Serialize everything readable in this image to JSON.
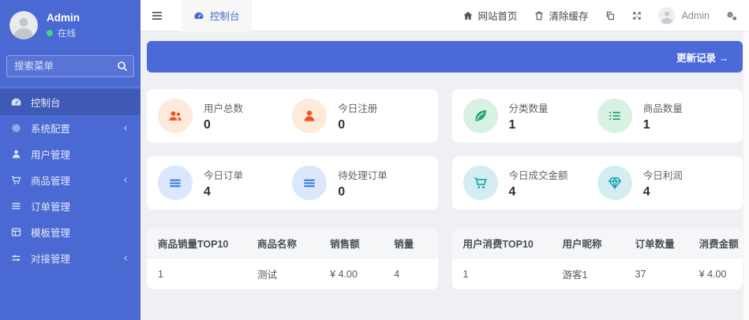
{
  "sidebar": {
    "user": {
      "name": "Admin",
      "status": "在线"
    },
    "search_placeholder": "搜索菜单",
    "items": [
      {
        "label": "控制台",
        "icon": "dashboard-icon"
      },
      {
        "label": "系统配置",
        "icon": "gear-icon"
      },
      {
        "label": "用户管理",
        "icon": "user-icon"
      },
      {
        "label": "商品管理",
        "icon": "cart-icon"
      },
      {
        "label": "订单管理",
        "icon": "list-icon"
      },
      {
        "label": "模板管理",
        "icon": "template-icon"
      },
      {
        "label": "对接管理",
        "icon": "sliders-icon"
      }
    ]
  },
  "navbar": {
    "tab_label": "控制台",
    "home_label": "网站首页",
    "clear_cache_label": "清除缓存",
    "user_name": "Admin"
  },
  "banner": {
    "link_label": "更新记录 →"
  },
  "stats": [
    {
      "label": "用户总数",
      "value": "0",
      "icon": "users-icon",
      "theme": "orange"
    },
    {
      "label": "今日注册",
      "value": "0",
      "icon": "user-icon",
      "theme": "orange"
    },
    {
      "label": "分类数量",
      "value": "1",
      "icon": "leaf-icon",
      "theme": "green"
    },
    {
      "label": "商品数量",
      "value": "1",
      "icon": "list-icon",
      "theme": "green"
    },
    {
      "label": "今日订单",
      "value": "4",
      "icon": "bars-icon",
      "theme": "blue"
    },
    {
      "label": "待处理订单",
      "value": "0",
      "icon": "bars-icon",
      "theme": "blue"
    },
    {
      "label": "今日成交金额",
      "value": "4",
      "icon": "cart-icon",
      "theme": "teal"
    },
    {
      "label": "今日利润",
      "value": "4",
      "icon": "gem-icon",
      "theme": "teal"
    }
  ],
  "tables": [
    {
      "headers": [
        "商品销量TOP10",
        "商品名称",
        "销售额",
        "销量"
      ],
      "rows": [
        [
          "1",
          "测试",
          "¥ 4.00",
          "4"
        ]
      ]
    },
    {
      "headers": [
        "用户消费TOP10",
        "用户昵称",
        "订单数量",
        "消费金额"
      ],
      "rows": [
        [
          "1",
          "游客1",
          "37",
          "¥ 4.00"
        ]
      ]
    }
  ],
  "colors": {
    "sidebar_bg": "#4a69d3",
    "banner_bg": "#4b6ad8",
    "content_bg": "#eef0f3",
    "active_item_overlay": "rgba(0,0,0,0.14)",
    "online_dot": "#3bd68a",
    "orange_fg": "#f4511e",
    "orange_bg": "#fdeada",
    "green_fg": "#23a96a",
    "green_bg": "#d7f1e3",
    "blue_fg": "#3d7be8",
    "blue_bg": "#dbe7fc",
    "teal_fg": "#13a3b5",
    "teal_bg": "#d4edf2"
  }
}
